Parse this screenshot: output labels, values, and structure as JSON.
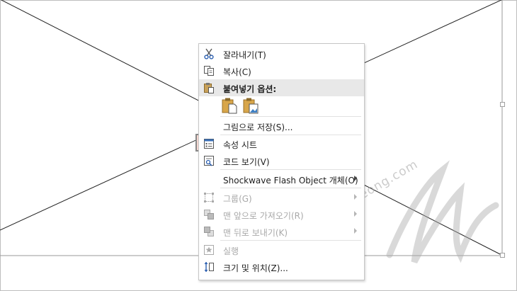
{
  "menu": {
    "items": [
      {
        "label": "잘라내기(T)",
        "icon": "scissors-icon",
        "enabled": true
      },
      {
        "label": "복사(C)",
        "icon": "copy-icon",
        "enabled": true
      },
      {
        "label": "붙여넣기 옵션:",
        "icon": "paste-icon",
        "enabled": true,
        "section_header": true
      },
      {
        "label": "그림으로 저장(S)...",
        "enabled": true
      },
      {
        "label": "속성 시트",
        "icon": "properties-icon",
        "enabled": true,
        "highlighted": true
      },
      {
        "label": "코드 보기(V)",
        "icon": "view-code-icon",
        "enabled": true
      },
      {
        "label": "Shockwave Flash Object 개체(O)",
        "enabled": true,
        "submenu": true
      },
      {
        "label": "그룹(G)",
        "icon": "group-icon",
        "enabled": false,
        "submenu": true
      },
      {
        "label": "맨 앞으로 가져오기(R)",
        "icon": "bring-to-front-icon",
        "enabled": false,
        "submenu": true
      },
      {
        "label": "맨 뒤로 보내기(K)",
        "icon": "send-to-back-icon",
        "enabled": false,
        "submenu": true
      },
      {
        "label": "실행",
        "icon": "action-icon",
        "enabled": false
      },
      {
        "label": "크기 및 위치(Z)...",
        "icon": "size-position-icon",
        "enabled": true
      }
    ],
    "paste_options": [
      "paste-keep-formatting-icon",
      "paste-picture-icon"
    ]
  },
  "watermark": "blog.hangyeong.com",
  "colors": {
    "highlight_bg": "#fadcd5",
    "highlight_border": "#888888",
    "section_bg": "#e8e8e8",
    "disabled_text": "#a9a9a9"
  }
}
